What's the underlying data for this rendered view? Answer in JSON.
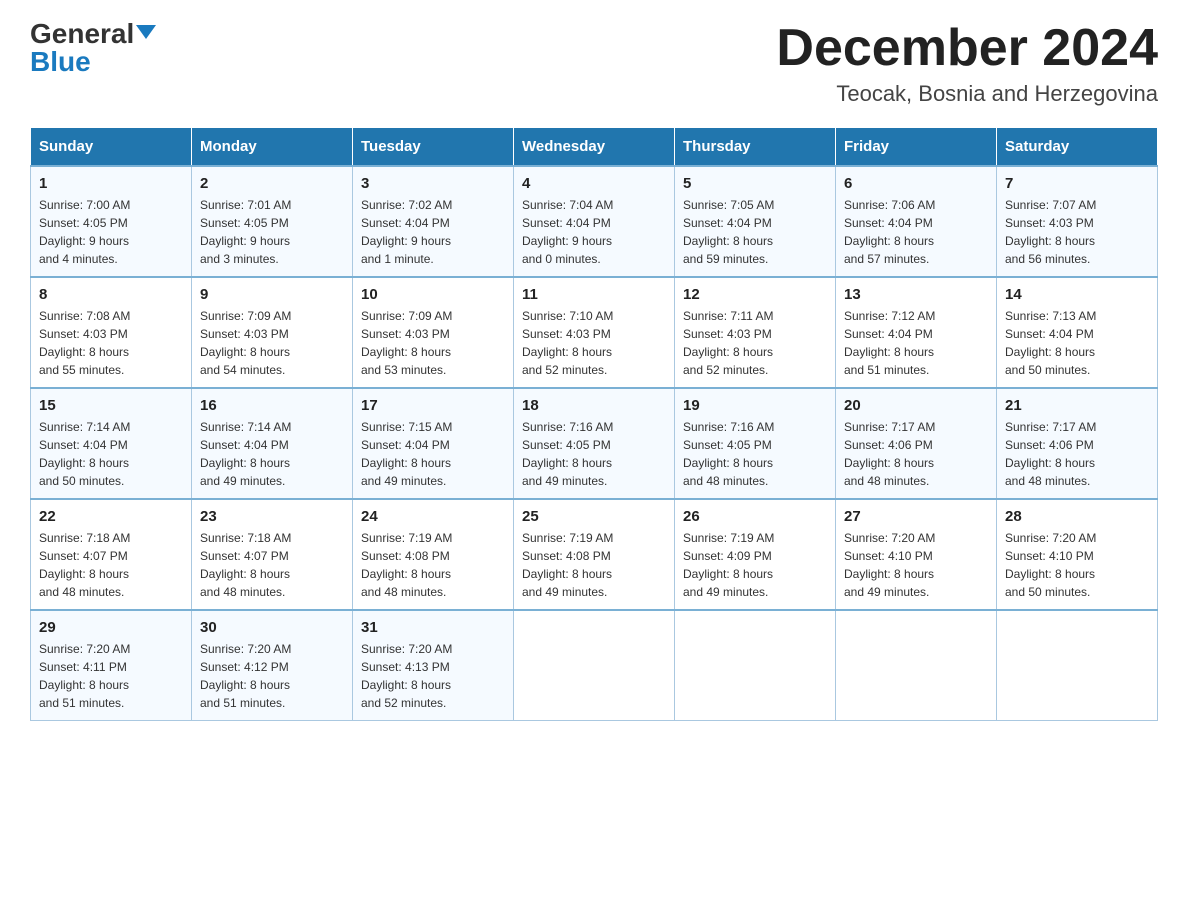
{
  "header": {
    "logo_general": "General",
    "logo_blue": "Blue",
    "month_title": "December 2024",
    "location": "Teocak, Bosnia and Herzegovina"
  },
  "days_of_week": [
    "Sunday",
    "Monday",
    "Tuesday",
    "Wednesday",
    "Thursday",
    "Friday",
    "Saturday"
  ],
  "weeks": [
    [
      {
        "day": "1",
        "sunrise": "7:00 AM",
        "sunset": "4:05 PM",
        "daylight": "9 hours and 4 minutes."
      },
      {
        "day": "2",
        "sunrise": "7:01 AM",
        "sunset": "4:05 PM",
        "daylight": "9 hours and 3 minutes."
      },
      {
        "day": "3",
        "sunrise": "7:02 AM",
        "sunset": "4:04 PM",
        "daylight": "9 hours and 1 minute."
      },
      {
        "day": "4",
        "sunrise": "7:04 AM",
        "sunset": "4:04 PM",
        "daylight": "9 hours and 0 minutes."
      },
      {
        "day": "5",
        "sunrise": "7:05 AM",
        "sunset": "4:04 PM",
        "daylight": "8 hours and 59 minutes."
      },
      {
        "day": "6",
        "sunrise": "7:06 AM",
        "sunset": "4:04 PM",
        "daylight": "8 hours and 57 minutes."
      },
      {
        "day": "7",
        "sunrise": "7:07 AM",
        "sunset": "4:03 PM",
        "daylight": "8 hours and 56 minutes."
      }
    ],
    [
      {
        "day": "8",
        "sunrise": "7:08 AM",
        "sunset": "4:03 PM",
        "daylight": "8 hours and 55 minutes."
      },
      {
        "day": "9",
        "sunrise": "7:09 AM",
        "sunset": "4:03 PM",
        "daylight": "8 hours and 54 minutes."
      },
      {
        "day": "10",
        "sunrise": "7:09 AM",
        "sunset": "4:03 PM",
        "daylight": "8 hours and 53 minutes."
      },
      {
        "day": "11",
        "sunrise": "7:10 AM",
        "sunset": "4:03 PM",
        "daylight": "8 hours and 52 minutes."
      },
      {
        "day": "12",
        "sunrise": "7:11 AM",
        "sunset": "4:03 PM",
        "daylight": "8 hours and 52 minutes."
      },
      {
        "day": "13",
        "sunrise": "7:12 AM",
        "sunset": "4:04 PM",
        "daylight": "8 hours and 51 minutes."
      },
      {
        "day": "14",
        "sunrise": "7:13 AM",
        "sunset": "4:04 PM",
        "daylight": "8 hours and 50 minutes."
      }
    ],
    [
      {
        "day": "15",
        "sunrise": "7:14 AM",
        "sunset": "4:04 PM",
        "daylight": "8 hours and 50 minutes."
      },
      {
        "day": "16",
        "sunrise": "7:14 AM",
        "sunset": "4:04 PM",
        "daylight": "8 hours and 49 minutes."
      },
      {
        "day": "17",
        "sunrise": "7:15 AM",
        "sunset": "4:04 PM",
        "daylight": "8 hours and 49 minutes."
      },
      {
        "day": "18",
        "sunrise": "7:16 AM",
        "sunset": "4:05 PM",
        "daylight": "8 hours and 49 minutes."
      },
      {
        "day": "19",
        "sunrise": "7:16 AM",
        "sunset": "4:05 PM",
        "daylight": "8 hours and 48 minutes."
      },
      {
        "day": "20",
        "sunrise": "7:17 AM",
        "sunset": "4:06 PM",
        "daylight": "8 hours and 48 minutes."
      },
      {
        "day": "21",
        "sunrise": "7:17 AM",
        "sunset": "4:06 PM",
        "daylight": "8 hours and 48 minutes."
      }
    ],
    [
      {
        "day": "22",
        "sunrise": "7:18 AM",
        "sunset": "4:07 PM",
        "daylight": "8 hours and 48 minutes."
      },
      {
        "day": "23",
        "sunrise": "7:18 AM",
        "sunset": "4:07 PM",
        "daylight": "8 hours and 48 minutes."
      },
      {
        "day": "24",
        "sunrise": "7:19 AM",
        "sunset": "4:08 PM",
        "daylight": "8 hours and 48 minutes."
      },
      {
        "day": "25",
        "sunrise": "7:19 AM",
        "sunset": "4:08 PM",
        "daylight": "8 hours and 49 minutes."
      },
      {
        "day": "26",
        "sunrise": "7:19 AM",
        "sunset": "4:09 PM",
        "daylight": "8 hours and 49 minutes."
      },
      {
        "day": "27",
        "sunrise": "7:20 AM",
        "sunset": "4:10 PM",
        "daylight": "8 hours and 49 minutes."
      },
      {
        "day": "28",
        "sunrise": "7:20 AM",
        "sunset": "4:10 PM",
        "daylight": "8 hours and 50 minutes."
      }
    ],
    [
      {
        "day": "29",
        "sunrise": "7:20 AM",
        "sunset": "4:11 PM",
        "daylight": "8 hours and 51 minutes."
      },
      {
        "day": "30",
        "sunrise": "7:20 AM",
        "sunset": "4:12 PM",
        "daylight": "8 hours and 51 minutes."
      },
      {
        "day": "31",
        "sunrise": "7:20 AM",
        "sunset": "4:13 PM",
        "daylight": "8 hours and 52 minutes."
      },
      null,
      null,
      null,
      null
    ]
  ],
  "labels": {
    "sunrise": "Sunrise:",
    "sunset": "Sunset:",
    "daylight": "Daylight:"
  }
}
